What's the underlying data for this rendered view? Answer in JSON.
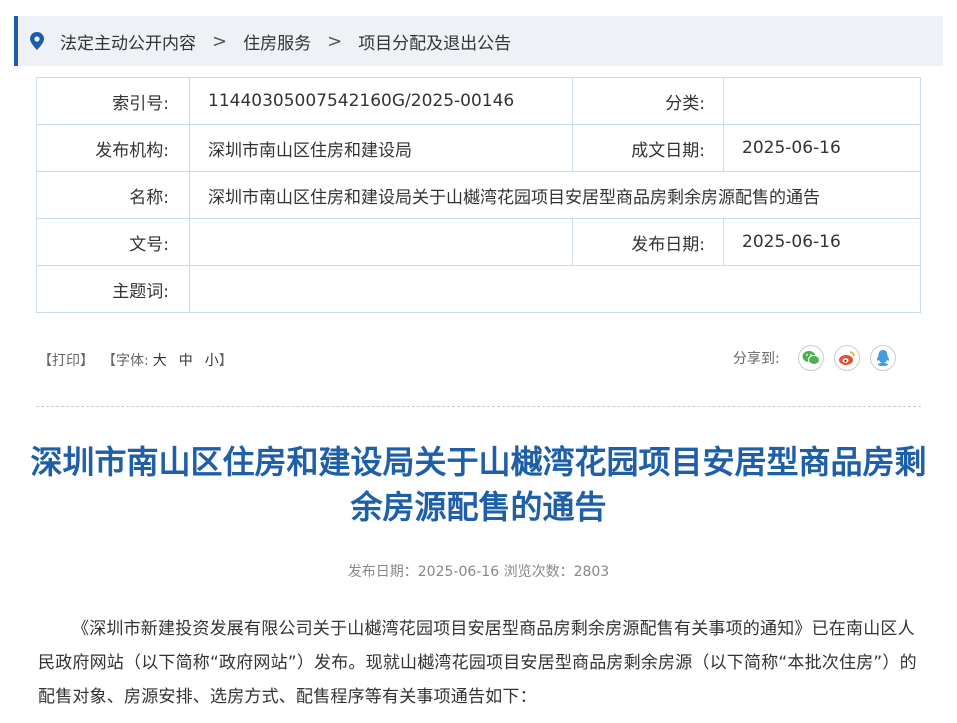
{
  "breadcrumb": {
    "items": [
      "法定主动公开内容",
      "住房服务",
      "项目分配及退出公告"
    ],
    "separator": ">"
  },
  "meta": {
    "index_label": "索引号:",
    "index_value": "11440305007542160G/2025-00146",
    "category_label": "分类:",
    "category_value": "",
    "publisher_label": "发布机构:",
    "publisher_value": "深圳市南山区住房和建设局",
    "written_date_label": "成文日期:",
    "written_date_value": "2025-06-16",
    "name_label": "名称:",
    "name_value": "深圳市南山区住房和建设局关于山樾湾花园项目安居型商品房剩余房源配售的通告",
    "doc_no_label": "文号:",
    "doc_no_value": "",
    "publish_date_label": "发布日期:",
    "publish_date_value": "2025-06-16",
    "subject_label": "主题词:",
    "subject_value": ""
  },
  "tools": {
    "print": "【打印】",
    "font_prefix": "【字体:",
    "font_large": "大",
    "font_medium": "中",
    "font_small": "小",
    "font_suffix": "】",
    "share_label": "分享到:"
  },
  "share_icons": [
    "wechat-icon",
    "weibo-icon",
    "qq-icon"
  ],
  "colors": {
    "accent": "#1d5ca8",
    "title": "#1e5fa8",
    "wechat": "#4cb050",
    "weibo": "#e6502d",
    "qq": "#3d9ee0"
  },
  "article": {
    "title": "深圳市南山区住房和建设局关于山樾湾花园项目安居型商品房剩余房源配售的通告",
    "pubinfo": "发布日期：2025-06-16  浏览次数：2803",
    "paragraph": "《深圳市新建投资发展有限公司关于山樾湾花园项目安居型商品房剩余房源配售有关事项的通知》已在南山区人民政府网站（以下简称“政府网站”）发布。现就山樾湾花园项目安居型商品房剩余房源（以下简称“本批次住房”）的配售对象、房源安排、选房方式、配售程序等有关事项通告如下："
  }
}
